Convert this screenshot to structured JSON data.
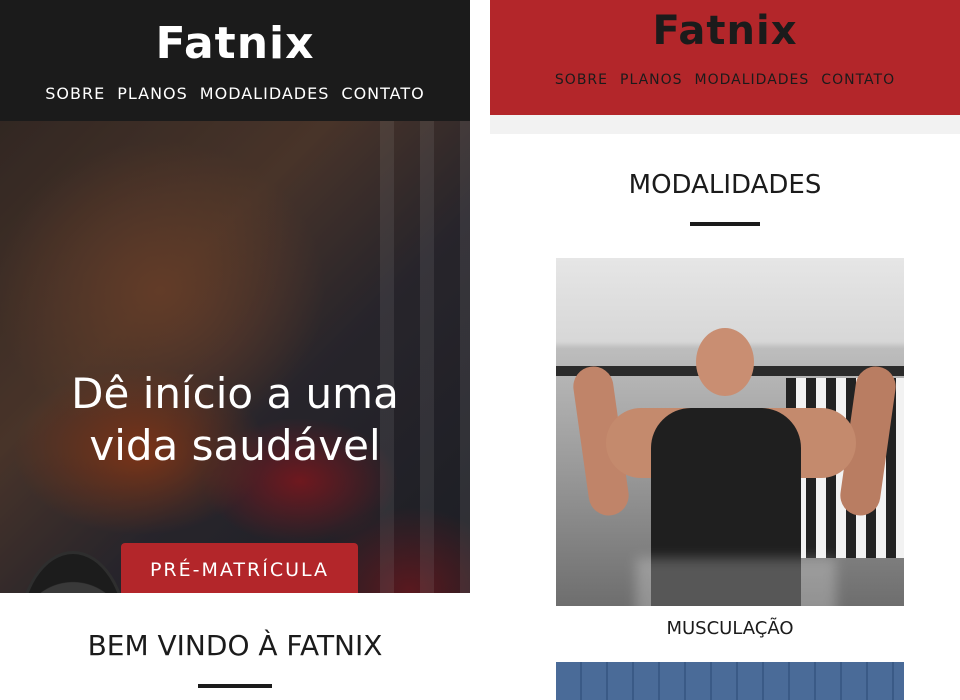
{
  "left": {
    "brand": "Fatnix",
    "nav": [
      "SOBRE",
      "PLANOS",
      "MODALIDADES",
      "CONTATO"
    ],
    "hero": {
      "title_line1": "Dê início a uma",
      "title_line2": "vida saudável",
      "cta_label": "PRÉ-MATRÍCULA"
    },
    "welcome_title": "BEM VINDO À FATNIX"
  },
  "right": {
    "brand": "Fatnix",
    "nav": [
      "SOBRE",
      "PLANOS",
      "MODALIDADES",
      "CONTATO"
    ],
    "section_title": "MODALIDADES",
    "cards": [
      {
        "caption": "MUSCULAÇÃO"
      }
    ]
  },
  "colors": {
    "accent_red": "#b3262a",
    "dark": "#1b1b1b",
    "light_strip": "#f2f2f2"
  },
  "icons": {
    "hero_image": "woman-lifting-dumbbell-photo",
    "card_image": "man-lat-pulldown-photo",
    "card2_image": "building-facade-photo"
  }
}
